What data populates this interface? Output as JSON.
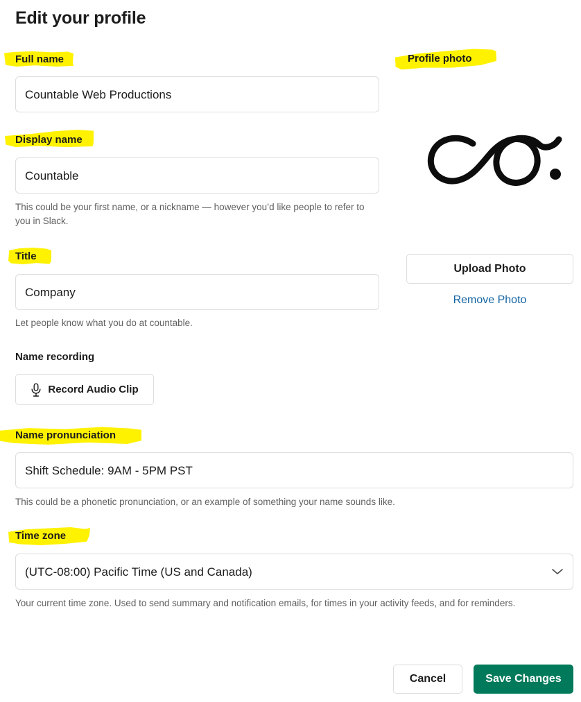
{
  "header": {
    "title": "Edit your profile"
  },
  "colors": {
    "highlight": "#fff200",
    "primary_button": "#007a5a",
    "link": "#1264a3",
    "text": "#1d1c1d",
    "helper_text": "#616061",
    "border": "#dddddd"
  },
  "form": {
    "full_name": {
      "label": "Full name",
      "value": "Countable Web Productions",
      "highlighted": true
    },
    "display_name": {
      "label": "Display name",
      "value": "Countable",
      "helper": "This could be your first name, or a nickname — however you’d like people to refer to you in Slack.",
      "highlighted": true
    },
    "title": {
      "label": "Title",
      "value": "Company",
      "helper": "Let people know what you do at countable.",
      "highlighted": true
    },
    "name_recording": {
      "label": "Name recording",
      "button_label": "Record Audio Clip",
      "icon": "microphone-icon",
      "highlighted": false
    },
    "name_pronunciation": {
      "label": "Name pronunciation",
      "value": "Shift Schedule: 9AM - 5PM PST",
      "helper": "This could be a phonetic pronunciation, or an example of something your name sounds like.",
      "highlighted": true
    },
    "time_zone": {
      "label": "Time zone",
      "value": "(UTC-08:00) Pacific Time (US and Canada)",
      "helper": "Your current time zone. Used to send summary and notification emails, for times in your activity feeds, and for reminders.",
      "icon": "chevron-down-icon",
      "highlighted": true
    }
  },
  "profile_photo": {
    "label": "Profile photo",
    "highlighted": true,
    "image_alt": "countable-logo",
    "upload_label": "Upload Photo",
    "remove_label": "Remove Photo"
  },
  "footer": {
    "cancel_label": "Cancel",
    "save_label": "Save Changes"
  }
}
